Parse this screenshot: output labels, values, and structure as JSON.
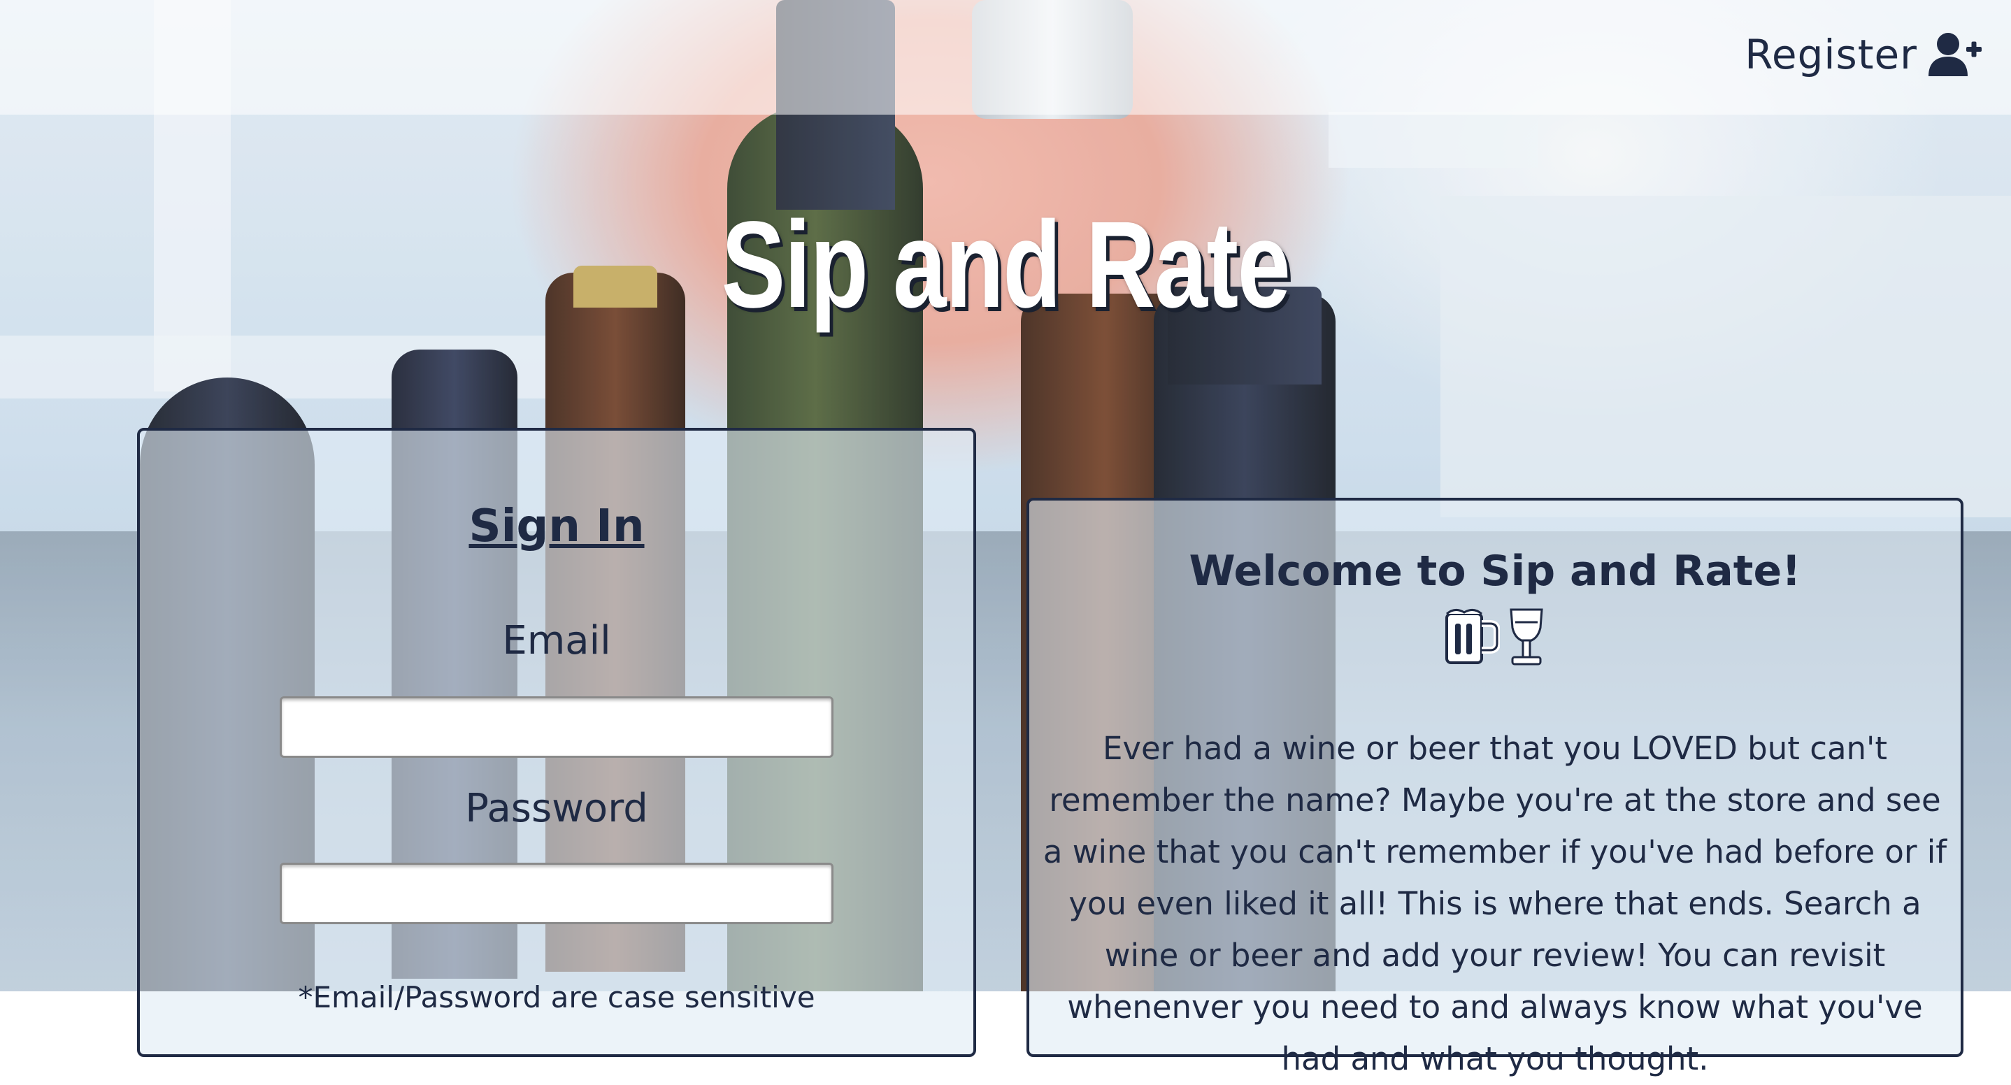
{
  "nav": {
    "register_label": "Register",
    "register_icon": "user-plus-icon"
  },
  "hero": {
    "title": "Sip and Rate"
  },
  "signin": {
    "title": "Sign In",
    "email_label": "Email",
    "email_value": "",
    "password_label": "Password",
    "password_value": "",
    "case_note": "*Email/Password are case sensitive"
  },
  "welcome": {
    "title": "Welcome to Sip and Rate!",
    "icons": [
      "beer-mug-icon",
      "wine-glass-icon"
    ],
    "body": "Ever had a wine or beer that you LOVED but can't remember the name? Maybe you're at the store and see a wine that you can't remember if you've had before or if you even liked it all! This is where that ends. Search a wine or beer and add your review! You can revisit whenenver you need to and always know what you've had and what you thought."
  },
  "colors": {
    "text": "#1f2a44",
    "panel_border": "#1f2a44",
    "title_text": "#ffffff",
    "title_shadow": "#1a2130"
  }
}
